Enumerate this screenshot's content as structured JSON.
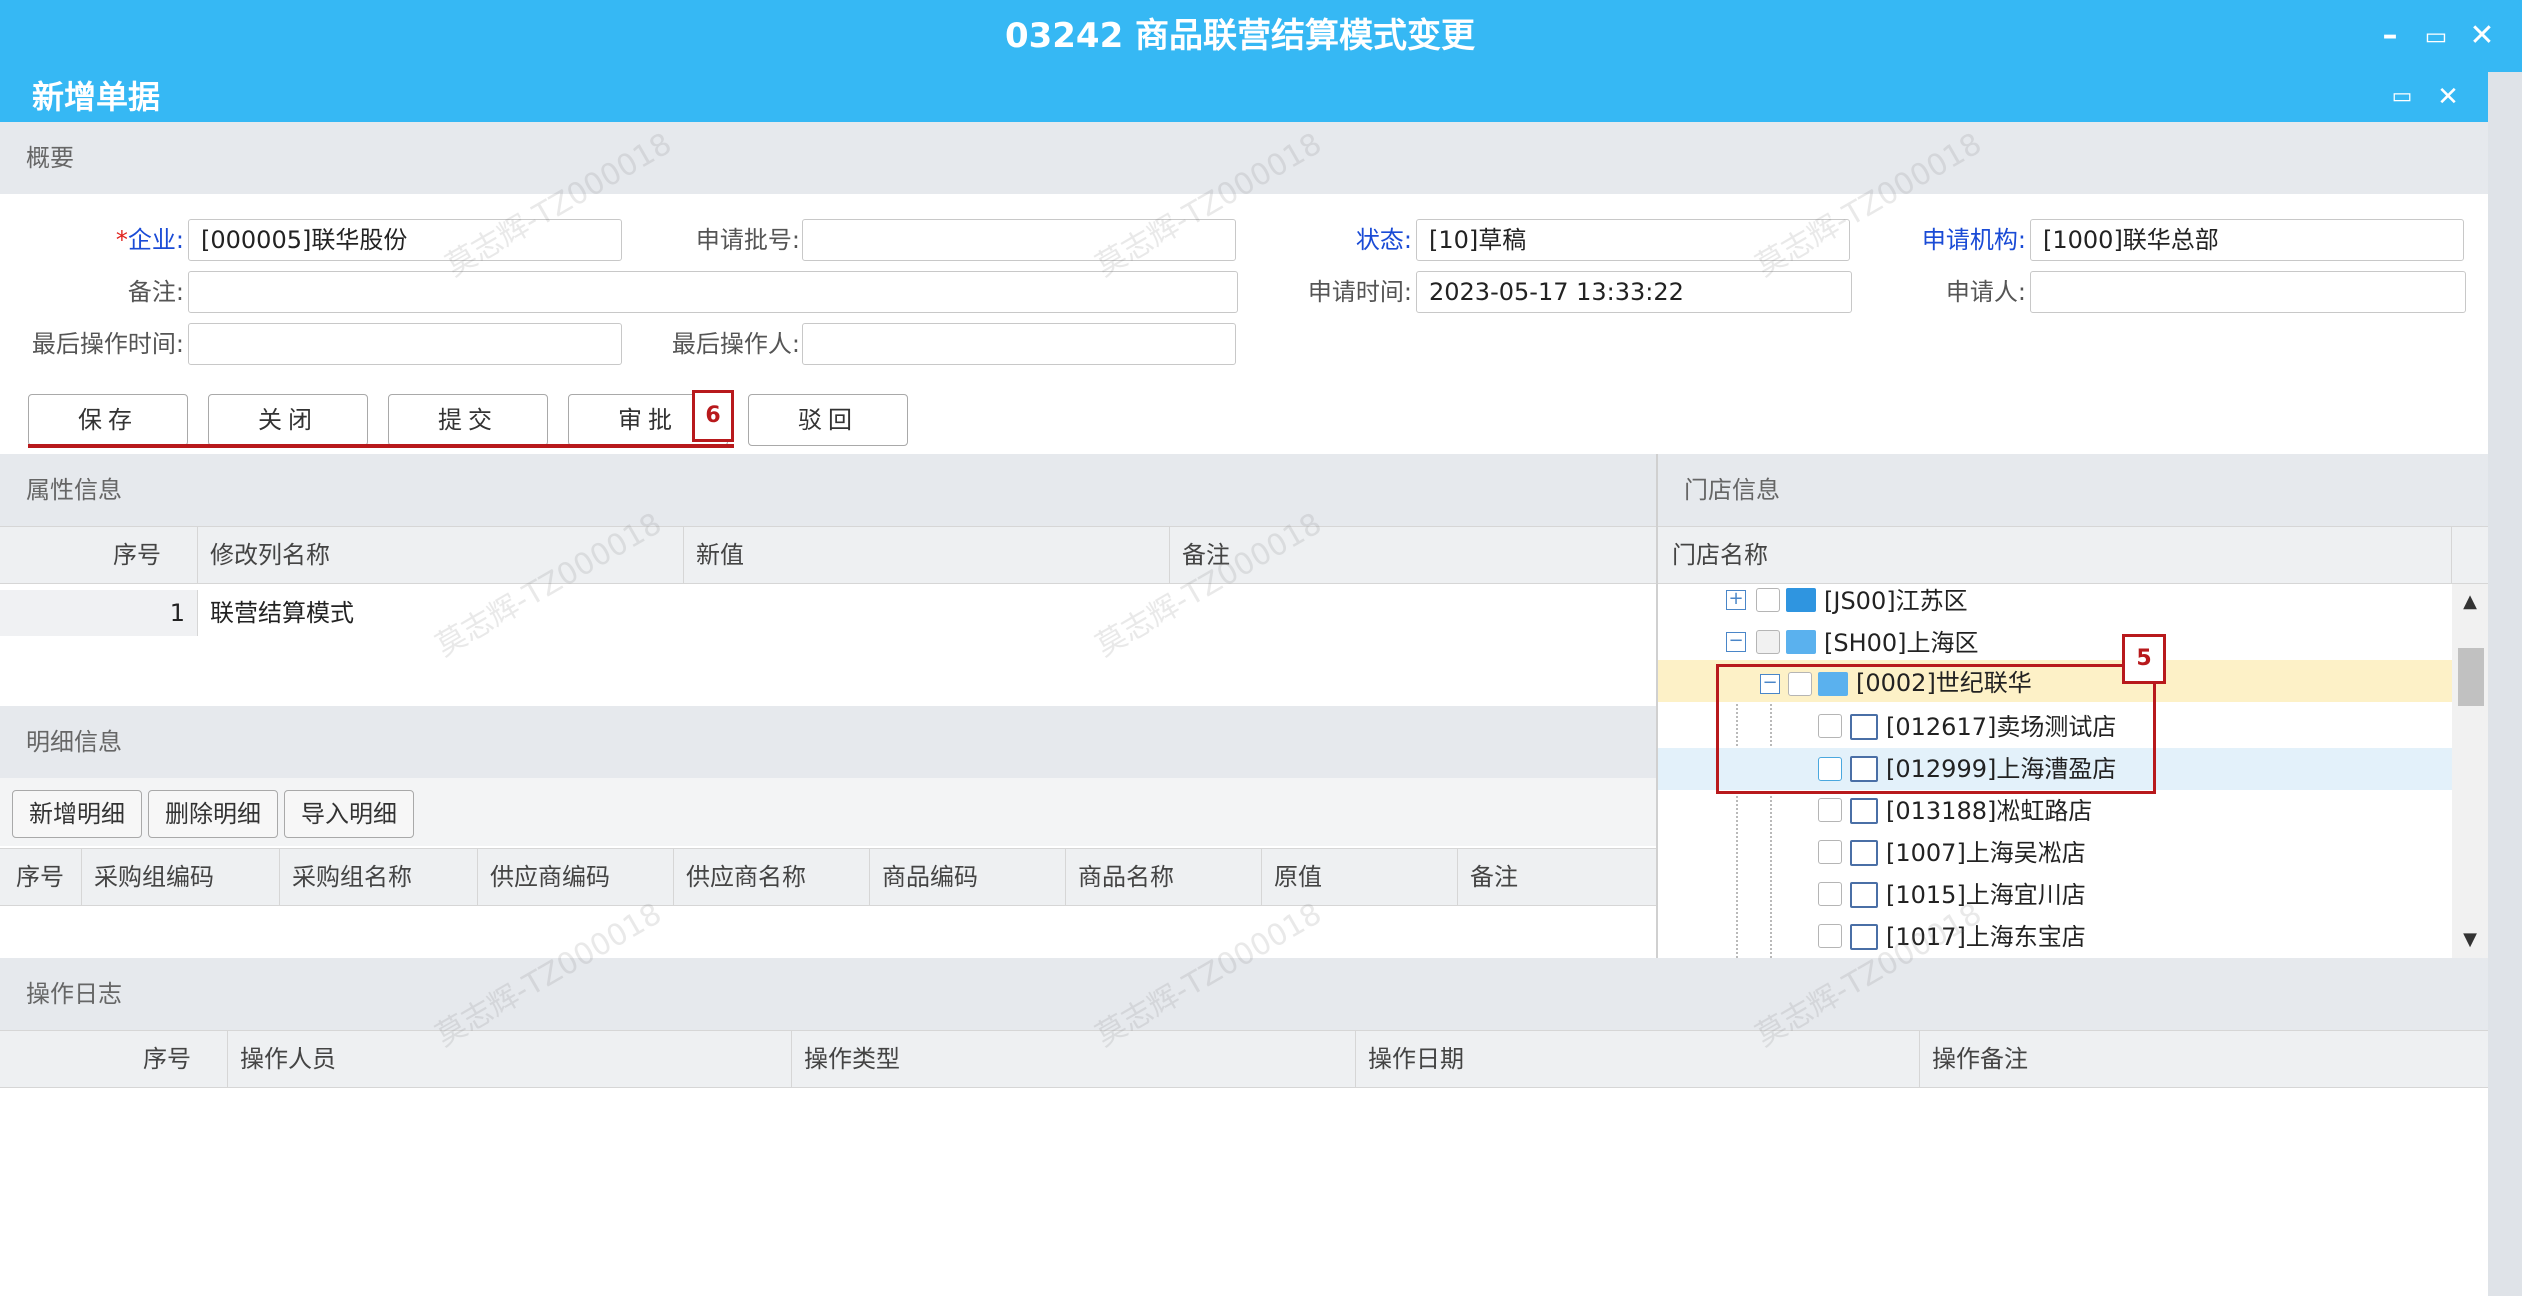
{
  "app": {
    "title": "03242 商品联营结算模式变更"
  },
  "dialog": {
    "title": "新增单据"
  },
  "summary": {
    "section_title": "概要",
    "fields": {
      "enterprise_required": "*",
      "enterprise_label": "企业:",
      "enterprise_value": "[000005]联华股份",
      "batch_label": "申请批号:",
      "batch_value": "",
      "status_label": "状态:",
      "status_value": "[10]草稿",
      "org_label": "申请机构:",
      "org_value": "[1000]联华总部",
      "remark_label": "备注:",
      "remark_value": "",
      "apply_time_label": "申请时间:",
      "apply_time_value": "2023-05-17 13:33:22",
      "applicant_label": "申请人:",
      "applicant_value": "",
      "last_op_time_label": "最后操作时间:",
      "last_op_time_value": "",
      "last_operator_label": "最后操作人:",
      "last_operator_value": ""
    },
    "buttons": {
      "save": "保存",
      "close": "关闭",
      "submit": "提交",
      "approve": "审批",
      "reject": "驳回"
    }
  },
  "annotations": {
    "badge_6": "6",
    "badge_5": "5"
  },
  "attributes": {
    "section_title": "属性信息",
    "columns": [
      "序号",
      "修改列名称",
      "新值",
      "备注"
    ],
    "rows": [
      {
        "index": "1",
        "name": "联营结算模式",
        "new_value": "",
        "remark": ""
      }
    ]
  },
  "details": {
    "section_title": "明细信息",
    "buttons": {
      "add": "新增明细",
      "delete": "删除明细",
      "import": "导入明细"
    },
    "columns": [
      "序号",
      "采购组编码",
      "采购组名称",
      "供应商编码",
      "供应商名称",
      "商品编码",
      "商品名称",
      "原值",
      "备注"
    ]
  },
  "stores": {
    "section_title": "门店信息",
    "column": "门店名称",
    "tree": [
      {
        "label": "[JS00]江苏区",
        "expander": "+"
      },
      {
        "label": "[SH00]上海区",
        "expander": "−"
      },
      {
        "label": "[0002]世纪联华",
        "expander": "−"
      },
      {
        "label": "[012617]卖场测试店"
      },
      {
        "label": "[012999]上海漕盈店"
      },
      {
        "label": "[013188]凇虹路店"
      },
      {
        "label": "[1007]上海吴凇店"
      },
      {
        "label": "[1015]上海宜川店"
      },
      {
        "label": "[1017]上海东宝店"
      }
    ]
  },
  "oplog": {
    "section_title": "操作日志",
    "columns": [
      "序号",
      "操作人员",
      "操作类型",
      "操作日期",
      "操作备注"
    ]
  },
  "icons": {
    "window_min": "minimize-icon",
    "window_restore": "restore-icon",
    "window_close": "close-icon",
    "scroll_up": "scroll-up-icon",
    "scroll_down": "scroll-down-icon"
  },
  "colors": {
    "titlebar": "#36b8f4",
    "accent_label": "#1a4bd6",
    "required": "#e0201b",
    "callout": "#b8191c",
    "tree_selected": "#fdf1c7",
    "tree_hover": "#e3f1fa"
  }
}
